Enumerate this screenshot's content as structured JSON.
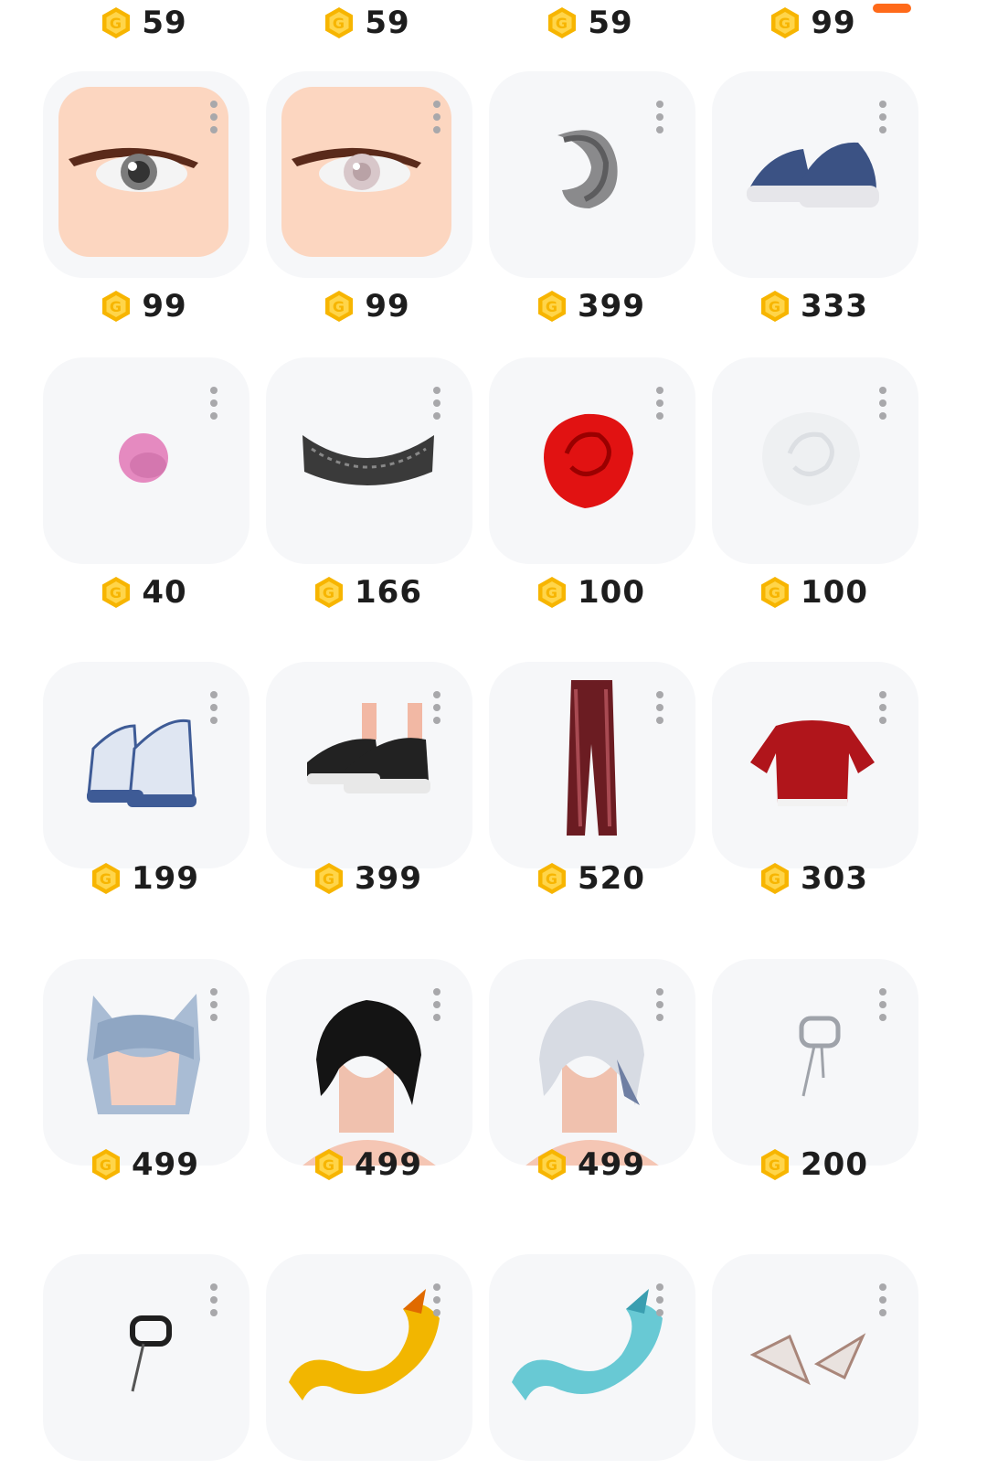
{
  "top_row": [
    "59",
    "59",
    "59",
    "99"
  ],
  "items": [
    {
      "price": "99",
      "icon": "eyes-item-icon"
    },
    {
      "price": "99",
      "icon": "eyes-item-icon"
    },
    {
      "price": "399",
      "icon": "fur-tail-icon"
    },
    {
      "price": "333",
      "icon": "sneakers-icon"
    },
    {
      "price": "40",
      "icon": "pink-ball-icon"
    },
    {
      "price": "166",
      "icon": "lace-choker-icon"
    },
    {
      "price": "100",
      "icon": "red-rose-icon"
    },
    {
      "price": "100",
      "icon": "white-rose-icon"
    },
    {
      "price": "199",
      "icon": "high-top-sneakers-icon"
    },
    {
      "price": "399",
      "icon": "black-sneakers-icon"
    },
    {
      "price": "520",
      "icon": "red-pants-icon"
    },
    {
      "price": "303",
      "icon": "red-hoodie-icon"
    },
    {
      "price": "499",
      "icon": "cat-ear-hair-icon"
    },
    {
      "price": "499",
      "icon": "black-hair-icon"
    },
    {
      "price": "499",
      "icon": "white-hair-icon"
    },
    {
      "price": "200",
      "icon": "chain-earring-icon"
    },
    {
      "price": "",
      "icon": "black-earring-icon"
    },
    {
      "price": "",
      "icon": "golden-dragon-icon"
    },
    {
      "price": "",
      "icon": "ice-dragon-icon"
    },
    {
      "price": "",
      "icon": "white-ears-icon"
    }
  ],
  "colors": {
    "coin": "#f7b500",
    "badge": "#ff6a1a",
    "card": "#f6f7f9",
    "kebab": "#a8a8ab"
  }
}
